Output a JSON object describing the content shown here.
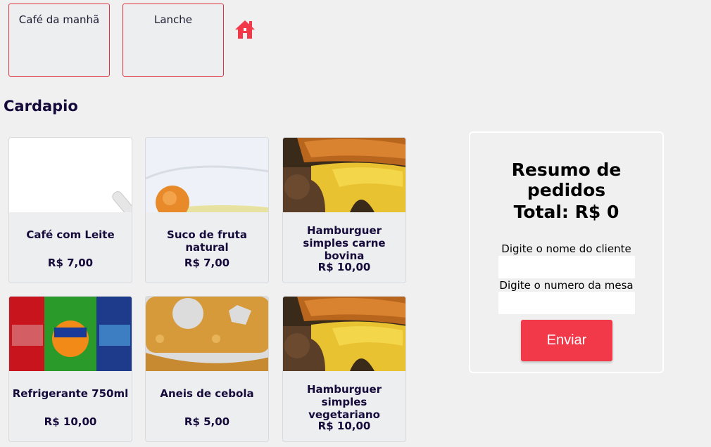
{
  "nav": {
    "tabs": [
      {
        "label": "Café da manhã"
      },
      {
        "label": "Lanche"
      }
    ],
    "home_icon": "home-icon",
    "accent_color": "#f2394a"
  },
  "menu": {
    "title": "Cardapio",
    "items": [
      {
        "name": "Café com Leite",
        "price": "R$ 7,00",
        "image": "coffee-with-milk"
      },
      {
        "name": "Suco de fruta natural",
        "price": "R$ 7,00",
        "image": "fruit-juice"
      },
      {
        "name": "Hamburguer simples carne bovina",
        "price": "R$ 10,00",
        "image": "burger"
      },
      {
        "name": "Refrigerante 750ml",
        "price": "R$ 10,00",
        "image": "soda-cans"
      },
      {
        "name": "Aneis de cebola",
        "price": "R$ 5,00",
        "image": "onion-rings"
      },
      {
        "name": "Hamburguer simples vegetariano",
        "price": "R$ 10,00",
        "image": "burger"
      }
    ]
  },
  "summary": {
    "title": "Resumo de pedidos",
    "total": "Total: R$ 0",
    "client_label": "Digite o nome do cliente",
    "client_value": "",
    "table_label": "Digite o numero da mesa",
    "table_value": "",
    "submit_label": "Enviar"
  }
}
